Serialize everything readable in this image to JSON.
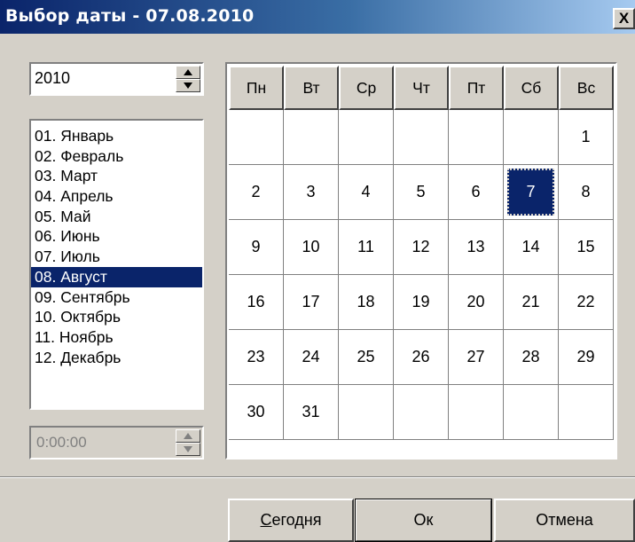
{
  "window": {
    "title": "Выбор даты - 07.08.2010",
    "close_label": "X"
  },
  "year": {
    "value": "2010"
  },
  "months": [
    "01. Январь",
    "02. Февраль",
    "03. Март",
    "04. Апрель",
    "05. Май",
    "06. Июнь",
    "07. Июль",
    "08. Август",
    "09. Сентябрь",
    "10. Октябрь",
    "11. Ноябрь",
    "12. Декабрь"
  ],
  "selected_month_index": 7,
  "time": {
    "value": "0:00:00",
    "disabled": true
  },
  "calendar": {
    "weekdays": [
      "Пн",
      "Вт",
      "Ср",
      "Чт",
      "Пт",
      "Сб",
      "Вс"
    ],
    "weeks": [
      [
        "",
        "",
        "",
        "",
        "",
        "",
        "1"
      ],
      [
        "2",
        "3",
        "4",
        "5",
        "6",
        "7",
        "8"
      ],
      [
        "9",
        "10",
        "11",
        "12",
        "13",
        "14",
        "15"
      ],
      [
        "16",
        "17",
        "18",
        "19",
        "20",
        "21",
        "22"
      ],
      [
        "23",
        "24",
        "25",
        "26",
        "27",
        "28",
        "29"
      ],
      [
        "30",
        "31",
        "",
        "",
        "",
        "",
        ""
      ]
    ],
    "selected_day": "7"
  },
  "buttons": {
    "today_accel": "С",
    "today_rest": "егодня",
    "ok": "Ок",
    "cancel": "Отмена"
  },
  "colors": {
    "title_start": "#0a246a",
    "title_end": "#a6caf0",
    "selection": "#0a246a",
    "face": "#d4d0c8"
  }
}
